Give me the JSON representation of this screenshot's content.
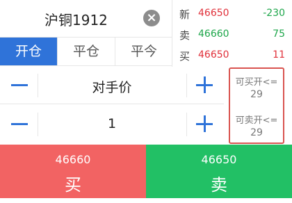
{
  "symbol": "沪铜1912",
  "tabs": [
    {
      "label": "开仓",
      "active": true
    },
    {
      "label": "平仓",
      "active": false
    },
    {
      "label": "平今",
      "active": false
    }
  ],
  "quotes": [
    {
      "label": "新",
      "price": "46650",
      "value": "-230",
      "price_color": "#e0303a",
      "value_color": "#1da64a"
    },
    {
      "label": "卖",
      "price": "46660",
      "value": "75",
      "price_color": "#1da64a",
      "value_color": "#1da64a"
    },
    {
      "label": "买",
      "price": "46650",
      "value": "11",
      "price_color": "#e0303a",
      "value_color": "#e0303a"
    }
  ],
  "price_mode": "对手价",
  "quantity": "1",
  "limits": {
    "buy_open_label": "可买开<=",
    "buy_open_value": "29",
    "sell_open_label": "可卖开<=",
    "sell_open_value": "29"
  },
  "buy_button": {
    "price": "46660",
    "label": "买",
    "color": "#f26363"
  },
  "sell_button": {
    "price": "46650",
    "label": "卖",
    "color": "#22c065"
  },
  "accent_color": "#2f73d9"
}
